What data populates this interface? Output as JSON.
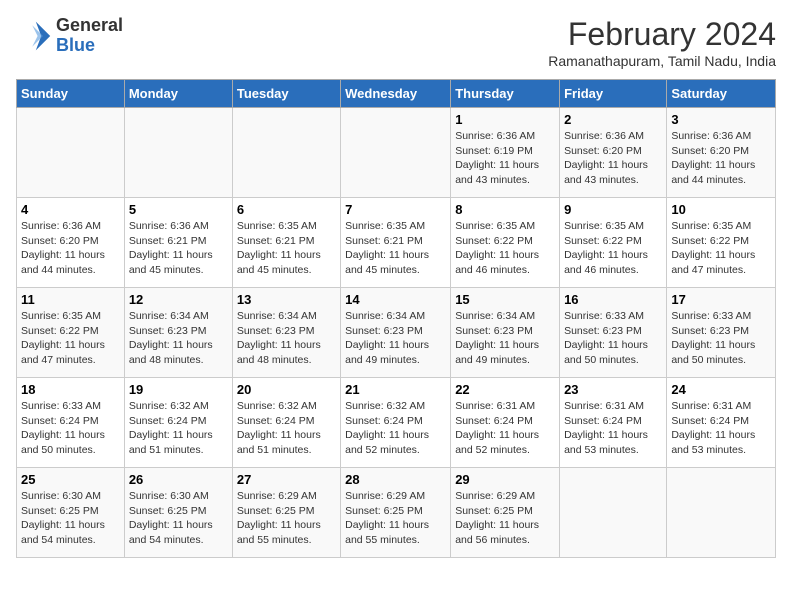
{
  "header": {
    "logo_line1": "General",
    "logo_line2": "Blue",
    "title": "February 2024",
    "subtitle": "Ramanathapuram, Tamil Nadu, India"
  },
  "days_of_week": [
    "Sunday",
    "Monday",
    "Tuesday",
    "Wednesday",
    "Thursday",
    "Friday",
    "Saturday"
  ],
  "weeks": [
    [
      {
        "date": "",
        "info": ""
      },
      {
        "date": "",
        "info": ""
      },
      {
        "date": "",
        "info": ""
      },
      {
        "date": "",
        "info": ""
      },
      {
        "date": "1",
        "info": "Sunrise: 6:36 AM\nSunset: 6:19 PM\nDaylight: 11 hours\nand 43 minutes."
      },
      {
        "date": "2",
        "info": "Sunrise: 6:36 AM\nSunset: 6:20 PM\nDaylight: 11 hours\nand 43 minutes."
      },
      {
        "date": "3",
        "info": "Sunrise: 6:36 AM\nSunset: 6:20 PM\nDaylight: 11 hours\nand 44 minutes."
      }
    ],
    [
      {
        "date": "4",
        "info": "Sunrise: 6:36 AM\nSunset: 6:20 PM\nDaylight: 11 hours\nand 44 minutes."
      },
      {
        "date": "5",
        "info": "Sunrise: 6:36 AM\nSunset: 6:21 PM\nDaylight: 11 hours\nand 45 minutes."
      },
      {
        "date": "6",
        "info": "Sunrise: 6:35 AM\nSunset: 6:21 PM\nDaylight: 11 hours\nand 45 minutes."
      },
      {
        "date": "7",
        "info": "Sunrise: 6:35 AM\nSunset: 6:21 PM\nDaylight: 11 hours\nand 45 minutes."
      },
      {
        "date": "8",
        "info": "Sunrise: 6:35 AM\nSunset: 6:22 PM\nDaylight: 11 hours\nand 46 minutes."
      },
      {
        "date": "9",
        "info": "Sunrise: 6:35 AM\nSunset: 6:22 PM\nDaylight: 11 hours\nand 46 minutes."
      },
      {
        "date": "10",
        "info": "Sunrise: 6:35 AM\nSunset: 6:22 PM\nDaylight: 11 hours\nand 47 minutes."
      }
    ],
    [
      {
        "date": "11",
        "info": "Sunrise: 6:35 AM\nSunset: 6:22 PM\nDaylight: 11 hours\nand 47 minutes."
      },
      {
        "date": "12",
        "info": "Sunrise: 6:34 AM\nSunset: 6:23 PM\nDaylight: 11 hours\nand 48 minutes."
      },
      {
        "date": "13",
        "info": "Sunrise: 6:34 AM\nSunset: 6:23 PM\nDaylight: 11 hours\nand 48 minutes."
      },
      {
        "date": "14",
        "info": "Sunrise: 6:34 AM\nSunset: 6:23 PM\nDaylight: 11 hours\nand 49 minutes."
      },
      {
        "date": "15",
        "info": "Sunrise: 6:34 AM\nSunset: 6:23 PM\nDaylight: 11 hours\nand 49 minutes."
      },
      {
        "date": "16",
        "info": "Sunrise: 6:33 AM\nSunset: 6:23 PM\nDaylight: 11 hours\nand 50 minutes."
      },
      {
        "date": "17",
        "info": "Sunrise: 6:33 AM\nSunset: 6:23 PM\nDaylight: 11 hours\nand 50 minutes."
      }
    ],
    [
      {
        "date": "18",
        "info": "Sunrise: 6:33 AM\nSunset: 6:24 PM\nDaylight: 11 hours\nand 50 minutes."
      },
      {
        "date": "19",
        "info": "Sunrise: 6:32 AM\nSunset: 6:24 PM\nDaylight: 11 hours\nand 51 minutes."
      },
      {
        "date": "20",
        "info": "Sunrise: 6:32 AM\nSunset: 6:24 PM\nDaylight: 11 hours\nand 51 minutes."
      },
      {
        "date": "21",
        "info": "Sunrise: 6:32 AM\nSunset: 6:24 PM\nDaylight: 11 hours\nand 52 minutes."
      },
      {
        "date": "22",
        "info": "Sunrise: 6:31 AM\nSunset: 6:24 PM\nDaylight: 11 hours\nand 52 minutes."
      },
      {
        "date": "23",
        "info": "Sunrise: 6:31 AM\nSunset: 6:24 PM\nDaylight: 11 hours\nand 53 minutes."
      },
      {
        "date": "24",
        "info": "Sunrise: 6:31 AM\nSunset: 6:24 PM\nDaylight: 11 hours\nand 53 minutes."
      }
    ],
    [
      {
        "date": "25",
        "info": "Sunrise: 6:30 AM\nSunset: 6:25 PM\nDaylight: 11 hours\nand 54 minutes."
      },
      {
        "date": "26",
        "info": "Sunrise: 6:30 AM\nSunset: 6:25 PM\nDaylight: 11 hours\nand 54 minutes."
      },
      {
        "date": "27",
        "info": "Sunrise: 6:29 AM\nSunset: 6:25 PM\nDaylight: 11 hours\nand 55 minutes."
      },
      {
        "date": "28",
        "info": "Sunrise: 6:29 AM\nSunset: 6:25 PM\nDaylight: 11 hours\nand 55 minutes."
      },
      {
        "date": "29",
        "info": "Sunrise: 6:29 AM\nSunset: 6:25 PM\nDaylight: 11 hours\nand 56 minutes."
      },
      {
        "date": "",
        "info": ""
      },
      {
        "date": "",
        "info": ""
      }
    ]
  ]
}
